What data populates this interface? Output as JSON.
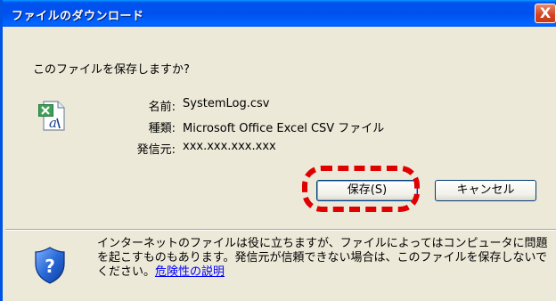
{
  "window": {
    "title": "ファイルのダウンロード",
    "close_glyph": "X"
  },
  "dialog": {
    "question": "このファイルを保存しますか?",
    "file_icon": "excel-csv-file-icon",
    "fields": {
      "name": {
        "label": "名前:",
        "value": "SystemLog.csv"
      },
      "type": {
        "label": "種類:",
        "value": "Microsoft Office Excel CSV ファイル"
      },
      "source": {
        "label": "発信元:",
        "value": "xxx.xxx.xxx.xxx"
      }
    },
    "buttons": {
      "save": "保存(S)",
      "cancel": "キャンセル"
    },
    "highlight_color": "#e00000"
  },
  "warning": {
    "icon": "security-shield-question-icon",
    "text": "インターネットのファイルは役に立ちますが、ファイルによってはコンピュータに問題を起こすものもあります。発信元が信頼できない場合は、このファイルを保存しないでください。",
    "link": "危険性の説明"
  },
  "colors": {
    "titlebar": "#0054e3",
    "dialog_bg": "#ece9d8",
    "link": "#0000ff"
  }
}
